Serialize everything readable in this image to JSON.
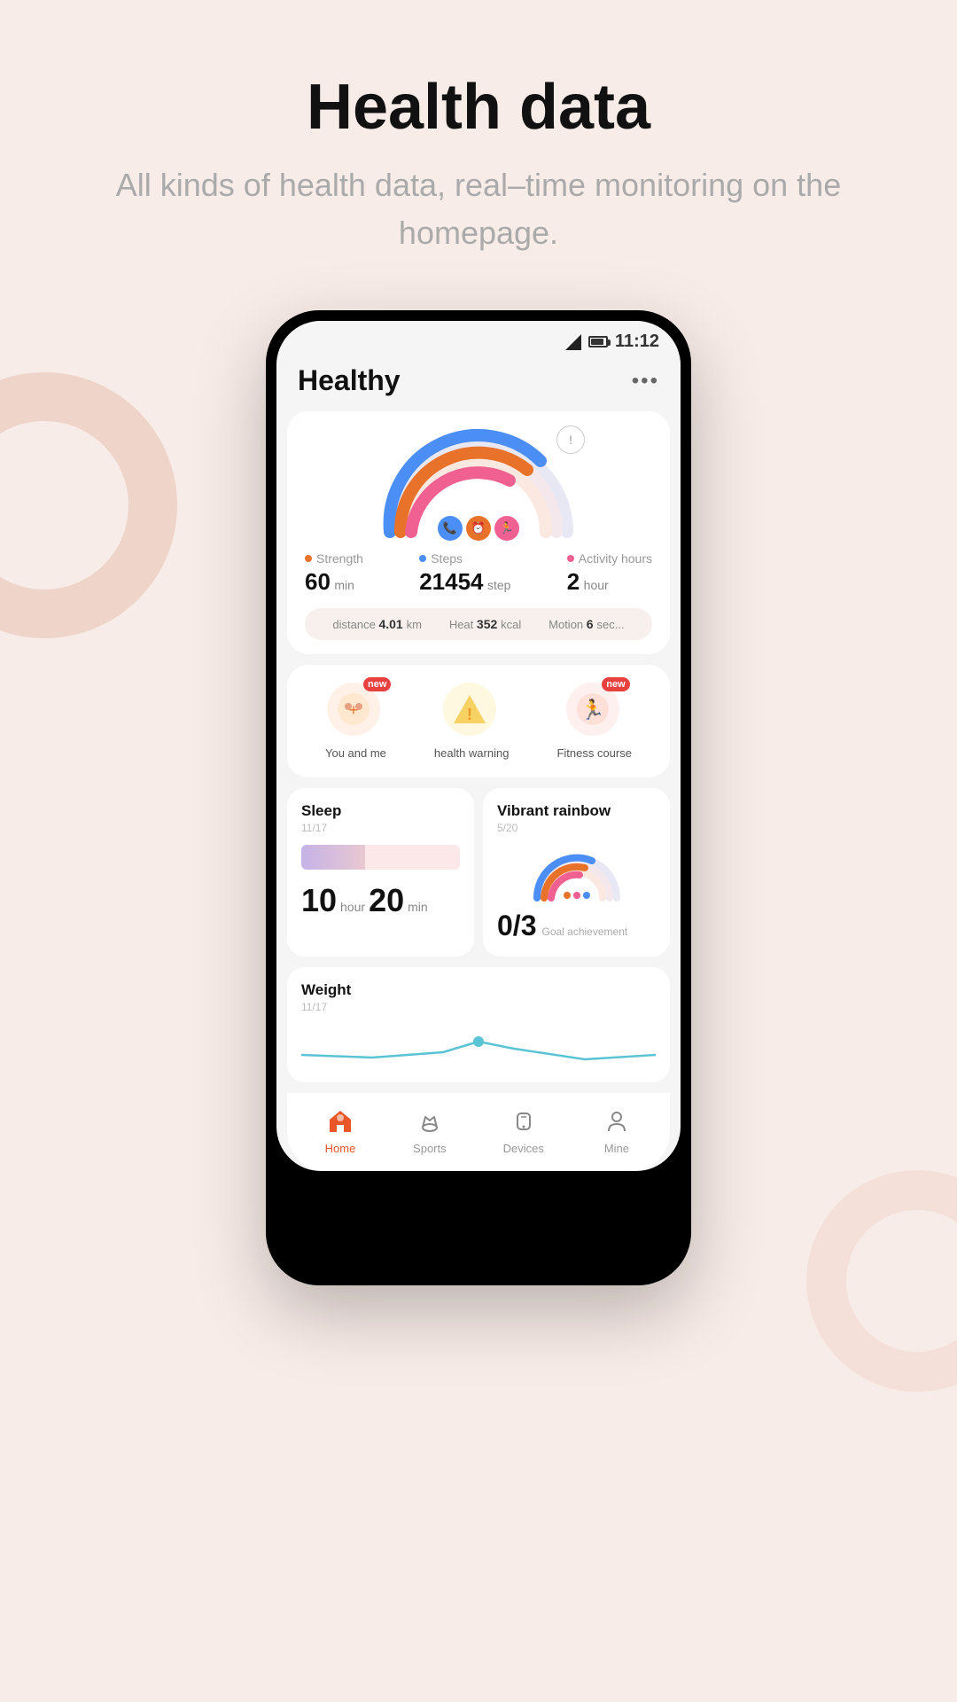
{
  "page": {
    "title": "Health data",
    "subtitle": "All kinds of health data, real–time monitoring on the homepage."
  },
  "statusBar": {
    "time": "11:12"
  },
  "appHeader": {
    "title": "Healthy",
    "more": "..."
  },
  "gauge": {
    "infoBtn": "!"
  },
  "stats": [
    {
      "label": "Strength",
      "color": "#e8722a",
      "value": "60",
      "unit": "min"
    },
    {
      "label": "Steps",
      "color": "#4b8ef5",
      "value": "21454",
      "unit": "step"
    },
    {
      "label": "Activity hours",
      "color": "#f06090",
      "value": "2",
      "unit": "hour"
    }
  ],
  "metrics": [
    {
      "label": "distance",
      "value": "4.01",
      "unit": "km"
    },
    {
      "label": "Heat",
      "value": "352",
      "unit": "kcal"
    },
    {
      "label": "Motion",
      "value": "6",
      "unit": "sec..."
    }
  ],
  "features": [
    {
      "label": "You and me",
      "icon": "➕",
      "bg": "#fff0e8",
      "new": true
    },
    {
      "label": "health warning",
      "icon": "⚠️",
      "bg": "#fff8e0",
      "new": false
    },
    {
      "label": "Fitness course",
      "icon": "🏃",
      "bg": "#fff0f0",
      "new": true
    }
  ],
  "sleepCard": {
    "title": "Sleep",
    "date": "11/17",
    "hours": "10",
    "hourLabel": "hour",
    "mins": "20",
    "minLabel": "min"
  },
  "rainbowCard": {
    "title": "Vibrant rainbow",
    "date": "5/20",
    "achievement": "0/3",
    "achieveLabel": "Goal achievement"
  },
  "weightCard": {
    "title": "Weight",
    "date": "11/17"
  },
  "nav": [
    {
      "label": "Home",
      "icon": "❤️",
      "active": true
    },
    {
      "label": "Sports",
      "icon": "👟",
      "active": false
    },
    {
      "label": "Devices",
      "icon": "⌚",
      "active": false
    },
    {
      "label": "Mine",
      "icon": "👤",
      "active": false
    }
  ]
}
